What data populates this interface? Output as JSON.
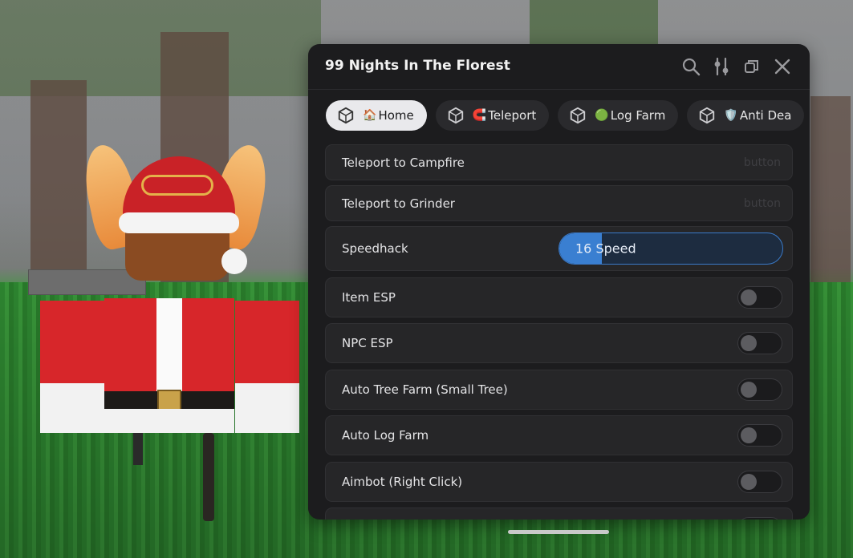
{
  "window": {
    "title": "99 Nights In The Florest"
  },
  "toolbar": {
    "icons": [
      "search-icon",
      "sliders-icon",
      "restore-icon",
      "close-icon"
    ]
  },
  "tabs": [
    {
      "emoji": "🏠",
      "label": "Home",
      "active": true
    },
    {
      "emoji": "🧲",
      "label": "Teleport",
      "active": false
    },
    {
      "emoji": "🟢",
      "label": "Log Farm",
      "active": false
    },
    {
      "emoji": "🛡️",
      "label": "Anti Dea",
      "active": false
    }
  ],
  "rows": [
    {
      "label": "Teleport to Campfire",
      "type": "button",
      "type_label": "button"
    },
    {
      "label": "Teleport to Grinder",
      "type": "button",
      "type_label": "button"
    },
    {
      "label": "Speedhack",
      "type": "slider",
      "slider_text": "16 Speed",
      "value_fraction": 0.19
    },
    {
      "label": "Item ESP",
      "type": "toggle",
      "enabled": false
    },
    {
      "label": "NPC ESP",
      "type": "toggle",
      "enabled": false
    },
    {
      "label": "Auto Tree Farm (Small Tree)",
      "type": "toggle",
      "enabled": false
    },
    {
      "label": "Auto Log Farm",
      "type": "toggle",
      "enabled": false
    },
    {
      "label": "Aimbot (Right Click)",
      "type": "toggle",
      "enabled": false
    }
  ],
  "colors": {
    "panel_bg": "#1c1c1e",
    "slider_accent": "#3a7fd1",
    "active_tab_bg": "#e9e9ec"
  }
}
